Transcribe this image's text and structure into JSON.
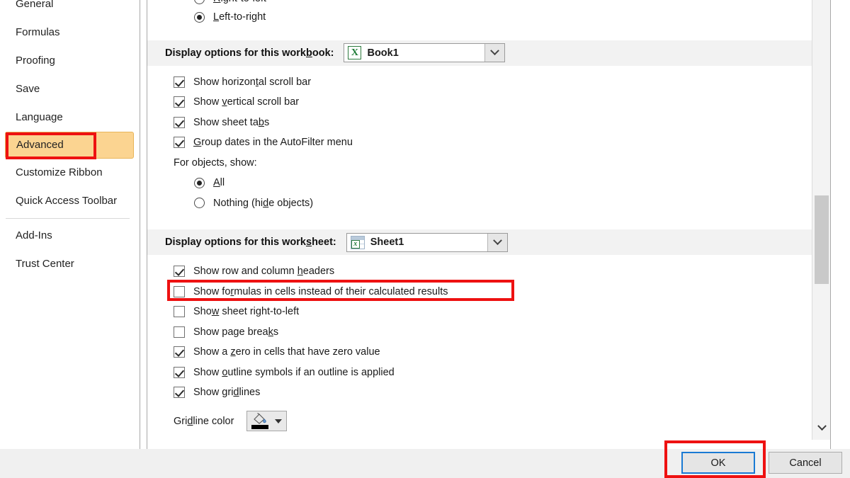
{
  "sidebar": {
    "items": [
      {
        "label": "General",
        "selected": false
      },
      {
        "label": "Formulas",
        "selected": false
      },
      {
        "label": "Proofing",
        "selected": false
      },
      {
        "label": "Save",
        "selected": false
      },
      {
        "label": "Language",
        "selected": false
      },
      {
        "label": "Advanced",
        "selected": true
      },
      {
        "label": "Customize Ribbon",
        "selected": false
      },
      {
        "label": "Quick Access Toolbar",
        "selected": false
      },
      {
        "label": "Add-Ins",
        "selected": false
      },
      {
        "label": "Trust Center",
        "selected": false
      }
    ]
  },
  "content": {
    "direction_options": [
      {
        "label": "Right-to-left",
        "checked": false
      },
      {
        "label": "Left-to-right",
        "checked": true
      }
    ],
    "workbook_section": {
      "band_label": "Display options for this workbook:",
      "combo_value": "Book1",
      "combo_icon": "excel-workbook-icon",
      "combo_arrow_icon": "chevron-down-icon",
      "checkboxes": [
        {
          "label": "Show horizontal scroll bar",
          "checked": true
        },
        {
          "label": "Show vertical scroll bar",
          "checked": true
        },
        {
          "label": "Show sheet tabs",
          "checked": true
        },
        {
          "label": "Group dates in the AutoFilter menu",
          "checked": true
        }
      ],
      "objects_label": "For objects, show:",
      "object_options": [
        {
          "label": "All",
          "checked": true
        },
        {
          "label": "Nothing (hide objects)",
          "checked": false
        }
      ]
    },
    "worksheet_section": {
      "band_label": "Display options for this worksheet:",
      "combo_value": "Sheet1",
      "combo_icon": "excel-worksheet-icon",
      "combo_arrow_icon": "chevron-down-icon",
      "checkboxes": [
        {
          "label": "Show row and column headers",
          "checked": true
        },
        {
          "label": "Show formulas in cells instead of their calculated results",
          "checked": false
        },
        {
          "label": "Show sheet right-to-left",
          "checked": false
        },
        {
          "label": "Show page breaks",
          "checked": false
        },
        {
          "label": "Show a zero in cells that have zero value",
          "checked": true
        },
        {
          "label": "Show outline symbols if an outline is applied",
          "checked": true
        },
        {
          "label": "Show gridlines",
          "checked": true
        }
      ],
      "gridline_color": {
        "label": "Gridline color",
        "button_icon": "paint-bucket-icon",
        "swatch_color": "#000000",
        "arrow_icon": "triangle-down-icon"
      }
    }
  },
  "scrollbar": {
    "up_icon": "chevron-up-icon",
    "down_icon": "chevron-down-icon"
  },
  "footer": {
    "ok_label": "OK",
    "cancel_label": "Cancel"
  },
  "annotations": {
    "accent_color": "#ee1111",
    "selection_color": "#fbd491",
    "focus_color": "#1a7ad4"
  }
}
